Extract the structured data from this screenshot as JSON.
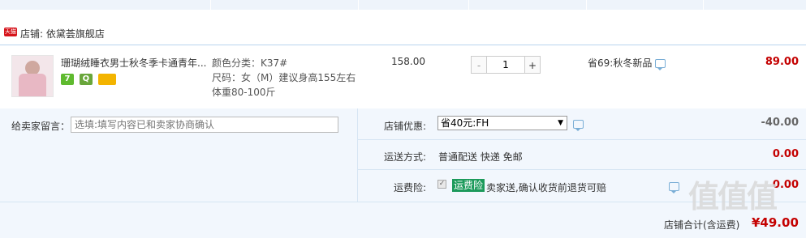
{
  "shop": {
    "label": "店铺:",
    "name": "依黛荟旗舰店",
    "badge": "天猫"
  },
  "item": {
    "title": "珊瑚绒睡衣男士秋冬季卡通青年...",
    "badges": [
      "7",
      "Q",
      ""
    ],
    "sku_color": "颜色分类：K37#",
    "sku_size": "尺码：女（M）建议身高155左右",
    "sku_weight": "体重80-100斤",
    "price": "158.00",
    "qty_minus": "-",
    "qty_value": "1",
    "qty_plus": "+",
    "promo": "省69:秋冬新品",
    "subtotal": "89.00"
  },
  "memo": {
    "label": "给卖家留言：",
    "placeholder": "选填:填写内容已和卖家协商确认"
  },
  "coupon": {
    "label": "店铺优惠:",
    "selected": "省40元:FH",
    "amount": "-40.00"
  },
  "shipping": {
    "label": "运送方式:",
    "text": "普通配送 快递 免邮",
    "amount": "0.00"
  },
  "insurance": {
    "label": "运费险:",
    "tag": "运费险",
    "text": "卖家送,确认收货前退货可赔",
    "amount": "0.00"
  },
  "total": {
    "label": "店铺合计(含运费)",
    "value": "¥49.00"
  },
  "watermark": "值值值",
  "colors": {
    "accent_red": "#c40000",
    "tmall_red": "#d6141b",
    "insurance_green": "#1c9a5b",
    "row_bg": "#f2f7fd"
  }
}
